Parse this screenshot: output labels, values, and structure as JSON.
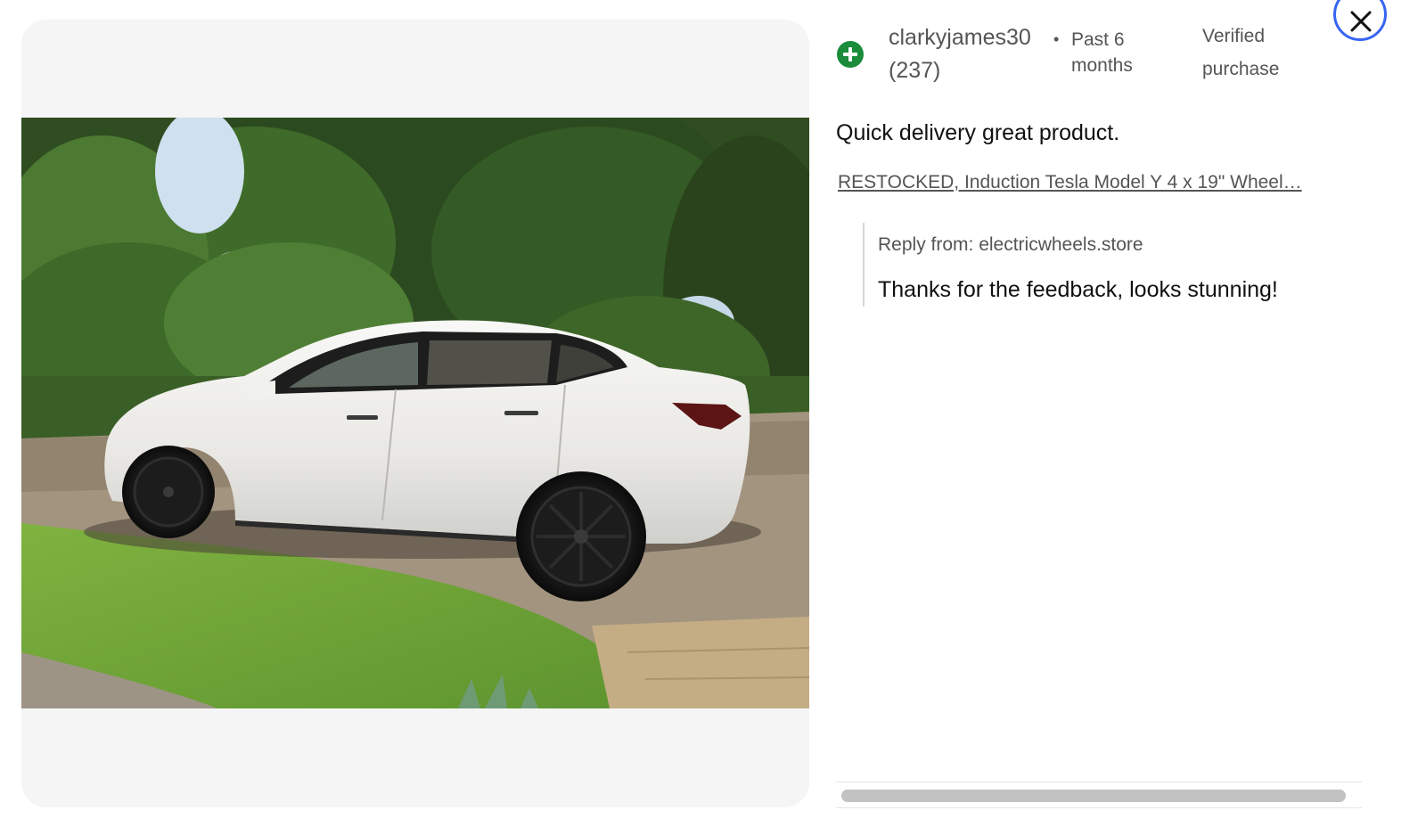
{
  "colors": {
    "accent_green": "#1a8c3a",
    "close_border": "#3665f3",
    "muted_text": "#555555",
    "photo_background": "#f5f5f5"
  },
  "photo": {
    "description_alt": "White SUV parked on a paved driveway beside grass and trees"
  },
  "review": {
    "icon": "plus-circle-icon",
    "username": "clarkyjames30",
    "feedback_count": "(237)",
    "time_bullet": "•",
    "time_period": "Past 6 months",
    "verified_label": "Verified purchase",
    "text": "Quick delivery great product.",
    "product_link": "RESTOCKED, Induction Tesla Model Y 4 x 19\" Wheel…",
    "reply": {
      "from_label": "Reply from: electricwheels.store",
      "text": "Thanks for the feedback, looks stunning!"
    }
  },
  "close_button": {
    "icon": "close-icon",
    "aria_label": "Close"
  },
  "scrollbar": {
    "thumb_fraction": 0.98
  }
}
